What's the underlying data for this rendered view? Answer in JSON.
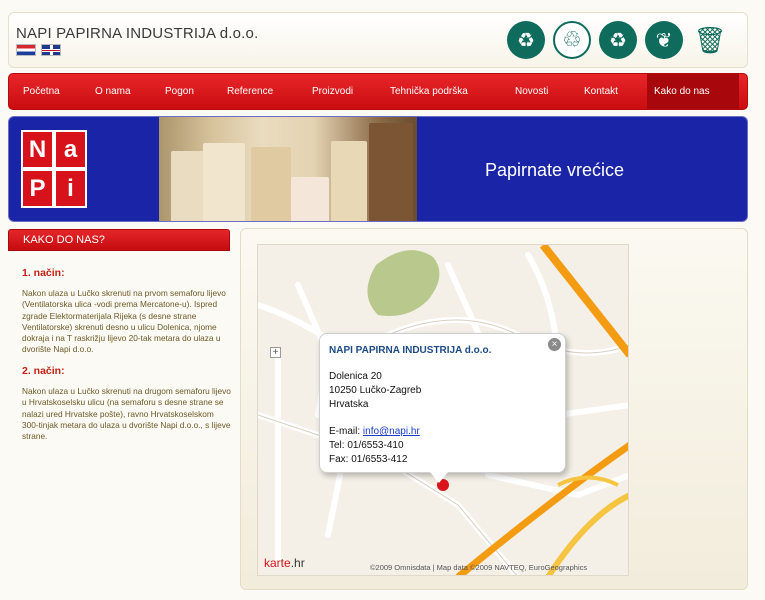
{
  "header": {
    "company": "NAPI PAPIRNA INDUSTRIJA d.o.o.",
    "languages": [
      "hr",
      "en"
    ],
    "eco_icons": [
      "recycle-circle-icon",
      "recycle-triangle-icon",
      "recycle-box-icon",
      "green-seal-icon",
      "trash-bin-icon"
    ]
  },
  "nav": {
    "items": [
      "Početna",
      "O nama",
      "Pogon",
      "Reference",
      "Proizvodi",
      "Tehnička podrška",
      "Novosti",
      "Kontakt",
      "Kako do nas"
    ],
    "active": "Kako do nas"
  },
  "banner": {
    "logo_letters": [
      "N",
      "a",
      "P",
      "i"
    ],
    "tagline": "Papirnate vrećice"
  },
  "sidebar": {
    "title": "KAKO DO NAS?",
    "routes": [
      {
        "heading": "1. način:",
        "text": "Nakon ulaza u Lučko skrenuti na prvom semaforu lijevo (Ventilatorska ulica -vodi prema Mercatone-u). Ispred zgrade Elektormaterijala Rijeka (s desne strane Ventilatorske) skrenuti desno u ulicu Dolenica, njome dokraja i na T raskrižju lijevo 20-tak metara do ulaza u dvorište Napi d.o.o."
      },
      {
        "heading": "2. način:",
        "text": "Nakon ulaza u Lučko skrenuti na drugom semaforu lijevo u Hrvatskoselsku ulicu (na semaforu s desne strane se nalazi ured Hrvatske pošte), ravno Hrvatskoselskom 300-tinjak metara do ulaza u dvorište Napi d.o.o., s lijeve strane."
      }
    ]
  },
  "map": {
    "popup": {
      "title": "NAPI PAPIRNA INDUSTRIJA d.o.o.",
      "street": "Dolenica 20",
      "city": "10250 Lučko-Zagreb",
      "country": "Hrvatska",
      "email_label": "E-mail:",
      "email": "info@napi.hr",
      "tel": "Tel: 01/6553-410",
      "fax": "Fax: 01/6553-412",
      "close": "×"
    },
    "zoom_in": "+",
    "brand_prefix": "karte",
    "brand_suffix": ".hr",
    "copyright": "©2009 Omnisdata | Map data ©2009 NAVTEQ, EuroGeographics"
  },
  "colors": {
    "nav_red": "#d81619",
    "banner_blue": "#1a24a6",
    "heading_red": "#c42014",
    "body_text": "#6b5a25",
    "eco_green": "#0f6b5c"
  }
}
